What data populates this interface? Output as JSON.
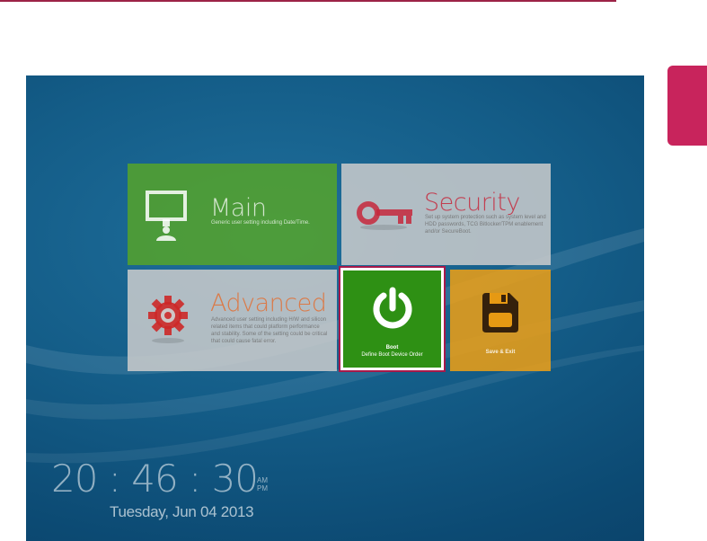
{
  "tiles": {
    "main": {
      "title": "Main",
      "description": "Generic user setting including Date/Time."
    },
    "security": {
      "title": "Security",
      "description": "Set up system protection such as system level and HDD passwords, TCG Bitlocker/TPM enablement and/or SecureBoot."
    },
    "advanced": {
      "title": "Advanced",
      "description": "Advanced user setting including H/W and silicon related items that could platform performance and stability. Some of the setting could be critical that could cause fatal error."
    },
    "boot": {
      "title": "Boot",
      "subtitle": "Define Boot Device Order"
    },
    "save_exit": {
      "title": "Save & Exit"
    }
  },
  "clock": {
    "time": "20 : 46 : 30",
    "am": "AM",
    "pm": "PM",
    "date": "Tuesday, Jun 04 2013"
  },
  "colors": {
    "accent": "#c8245c",
    "selection_border": "#a6194a",
    "main_tile": "#58a626",
    "boot_tile": "#2e9014",
    "save_tile": "#f0a014",
    "security_title": "#c6283c",
    "advanced_title": "#e26e32",
    "background": "#145d88"
  },
  "icons": {
    "main": "monitor-icon",
    "security": "key-icon",
    "advanced": "gear-icon",
    "boot": "power-icon",
    "save_exit": "floppy-disk-icon"
  }
}
